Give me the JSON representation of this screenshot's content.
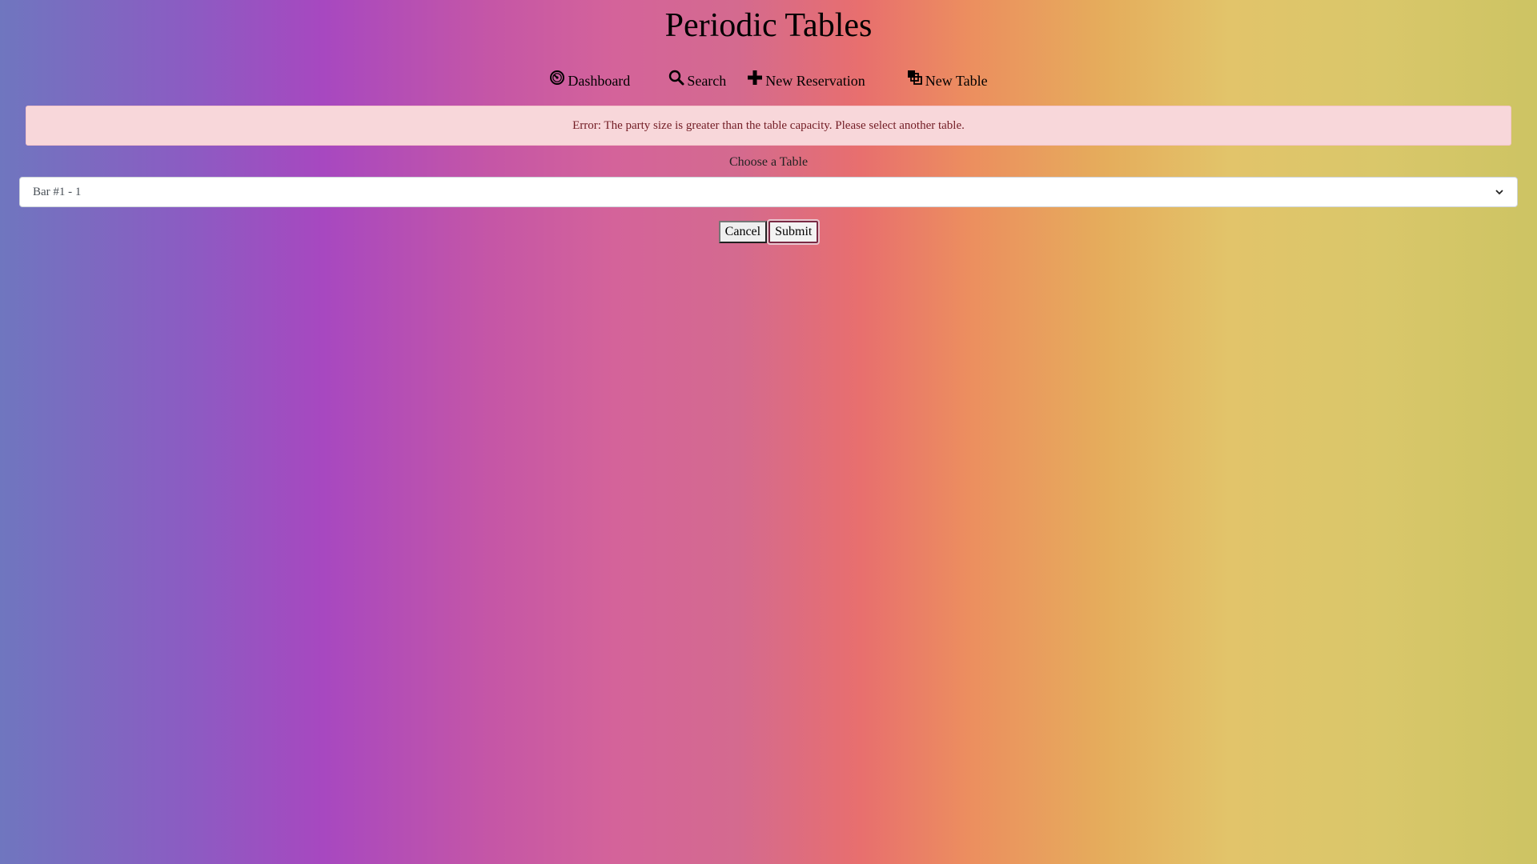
{
  "app": {
    "title": "Periodic Tables"
  },
  "nav": {
    "items": [
      {
        "label": "Dashboard",
        "icon": "dashboard-icon"
      },
      {
        "label": "Search",
        "icon": "search-icon"
      },
      {
        "label": "New Reservation",
        "icon": "plus-icon"
      },
      {
        "label": "New Table",
        "icon": "layers-icon"
      }
    ]
  },
  "alert": {
    "message": "Error: The party size is greater than the table capacity. Please select another table.",
    "type": "error"
  },
  "form": {
    "label": "Choose a Table",
    "select": {
      "selected": "Bar #1 - 1"
    },
    "cancel_label": "Cancel",
    "submit_label": "Submit"
  }
}
